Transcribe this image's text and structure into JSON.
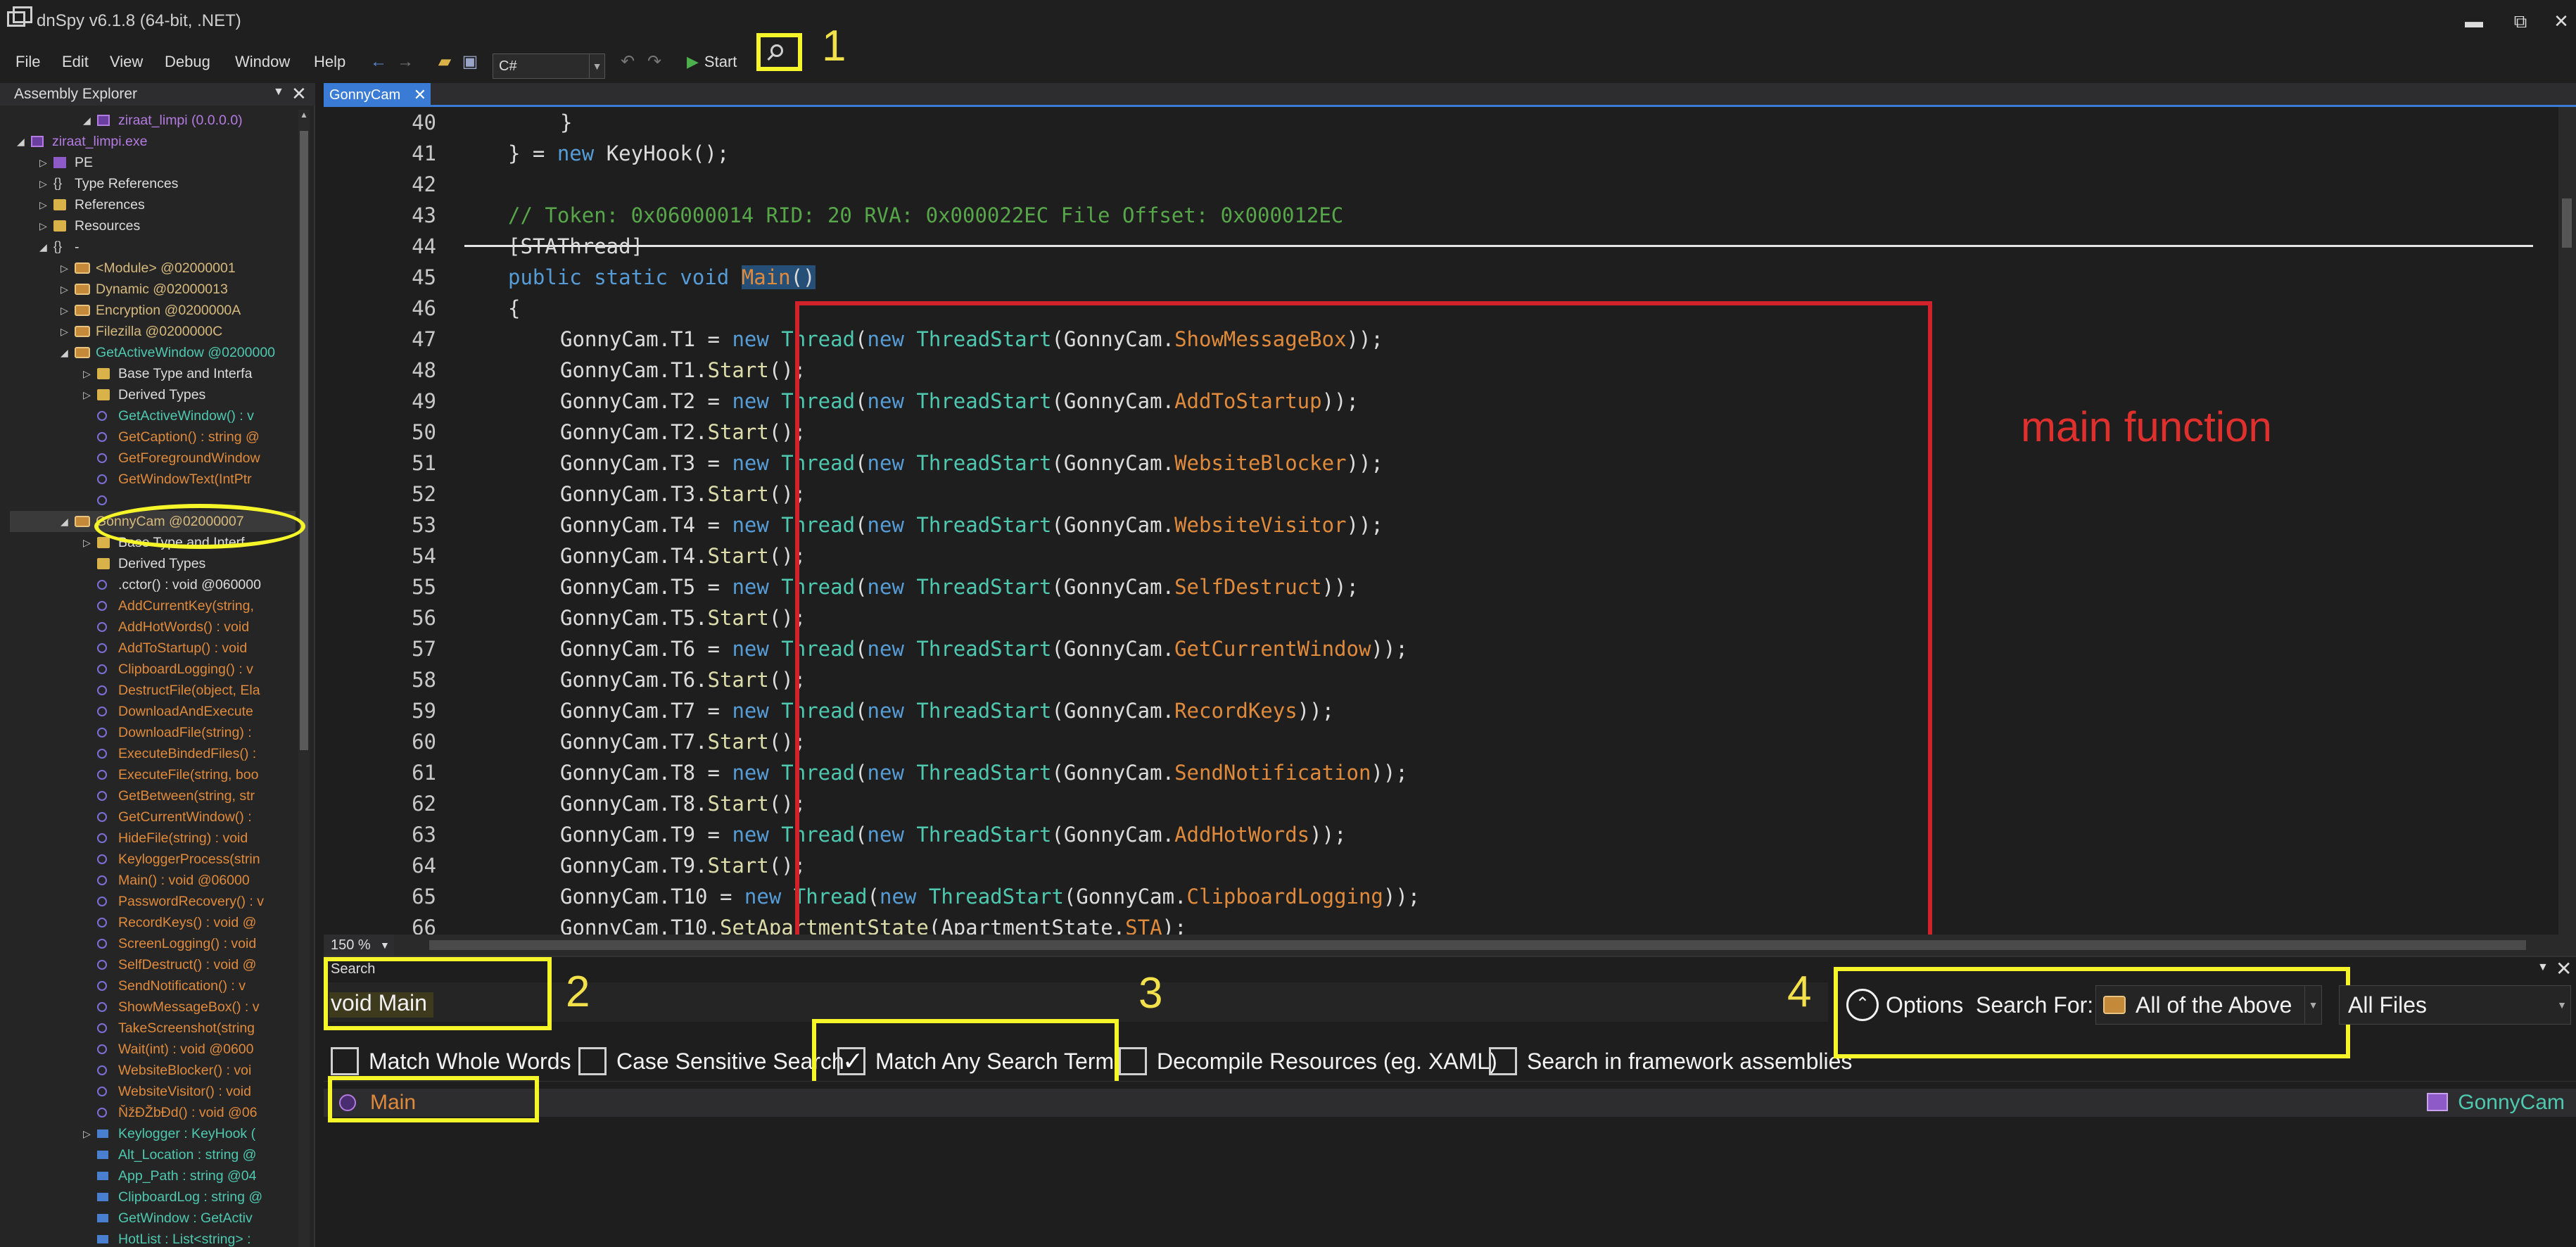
{
  "window": {
    "title": "dnSpy v6.1.8 (64-bit, .NET)",
    "min_glyph": "▬",
    "max_glyph": "⧉",
    "close_glyph": "✕",
    "colors": {
      "background": "#1e1e1e",
      "annotation": "#f5f52a",
      "main_box": "#d1222b",
      "accent": "#3a7bd5"
    }
  },
  "menu": {
    "items": [
      "File",
      "Edit",
      "View",
      "Debug",
      "Window",
      "Help"
    ],
    "language": "C#",
    "start_label": "Start",
    "icons": [
      "back-arrow-icon",
      "forward-arrow-icon",
      "open-file-icon",
      "save-all-icon",
      "undo-icon",
      "redo-icon",
      "search-icon"
    ]
  },
  "annotations": {
    "n1": "1",
    "n2": "2",
    "n3": "3",
    "n4": "4",
    "main_function": "main function"
  },
  "explorer": {
    "title": "Assembly Explorer",
    "rows": [
      {
        "text": "ziraat_limpi (0.0.0.0)",
        "color": "#b47be0"
      },
      {
        "text": "ziraat_limpi.exe",
        "color": "#b47be0"
      },
      {
        "text": "PE",
        "color": "#dcdcdc"
      },
      {
        "text": "Type References",
        "color": "#dcdcdc"
      },
      {
        "text": "References",
        "color": "#dcdcdc"
      },
      {
        "text": "Resources",
        "color": "#dcdcdc"
      },
      {
        "text": "-",
        "color": "#dcdcdc"
      },
      {
        "text": "<Module> @02000001",
        "color": "#d7ba7d"
      },
      {
        "text": "Dynamic @02000013",
        "color": "#d7ba7d"
      },
      {
        "text": "Encryption @0200000A",
        "color": "#d7ba7d"
      },
      {
        "text": "Filezilla @0200000C",
        "color": "#d7ba7d"
      },
      {
        "text": "GetActiveWindow @0200000",
        "color": "#4ec9b0"
      },
      {
        "text": "Base Type and Interfa",
        "color": "#dcdcdc"
      },
      {
        "text": "Derived Types",
        "color": "#dcdcdc"
      },
      {
        "text": "GetActiveWindow() : v",
        "color": "#4ec9b0"
      },
      {
        "text": "GetCaption() : string @",
        "color": "#e08a3c"
      },
      {
        "text": "GetForegroundWindow",
        "color": "#e08a3c"
      },
      {
        "text": "GetWindowText(IntPtr",
        "color": "#e08a3c"
      },
      {
        "text": "",
        "color": "#e08a3c"
      },
      {
        "text": "GonnyCam @02000007",
        "color": "#d7ba7d"
      },
      {
        "text": "Base Type and Interf",
        "color": "#dcdcdc"
      },
      {
        "text": "Derived Types",
        "color": "#dcdcdc"
      },
      {
        "text": ".cctor() : void @060000",
        "color": "#dcdcdc"
      },
      {
        "text": "AddCurrentKey(string,",
        "color": "#e08a3c"
      },
      {
        "text": "AddHotWords() : void",
        "color": "#e08a3c"
      },
      {
        "text": "AddToStartup() : void",
        "color": "#e08a3c"
      },
      {
        "text": "ClipboardLogging() : v",
        "color": "#e08a3c"
      },
      {
        "text": "DestructFile(object, Ela",
        "color": "#e08a3c"
      },
      {
        "text": "DownloadAndExecute",
        "color": "#e08a3c"
      },
      {
        "text": "DownloadFile(string) :",
        "color": "#e08a3c"
      },
      {
        "text": "ExecuteBindedFiles() :",
        "color": "#e08a3c"
      },
      {
        "text": "ExecuteFile(string, boo",
        "color": "#e08a3c"
      },
      {
        "text": "GetBetween(string, str",
        "color": "#e08a3c"
      },
      {
        "text": "GetCurrentWindow() :",
        "color": "#e08a3c"
      },
      {
        "text": "HideFile(string) : void",
        "color": "#e08a3c"
      },
      {
        "text": "KeyloggerProcess(strin",
        "color": "#e08a3c"
      },
      {
        "text": "Main() : void @06000",
        "color": "#e08a3c"
      },
      {
        "text": "PasswordRecovery() : v",
        "color": "#e08a3c"
      },
      {
        "text": "RecordKeys() : void @",
        "color": "#e08a3c"
      },
      {
        "text": "ScreenLogging() : void",
        "color": "#e08a3c"
      },
      {
        "text": "SelfDestruct() : void @",
        "color": "#e08a3c"
      },
      {
        "text": "SendNotification() : v",
        "color": "#e08a3c"
      },
      {
        "text": "ShowMessageBox() : v",
        "color": "#e08a3c"
      },
      {
        "text": "TakeScreenshot(string",
        "color": "#e08a3c"
      },
      {
        "text": "Wait(int) : void @0600",
        "color": "#e08a3c"
      },
      {
        "text": "WebsiteBlocker() : voi",
        "color": "#e08a3c"
      },
      {
        "text": "WebsiteVisitor() : void",
        "color": "#e08a3c"
      },
      {
        "text": "ŇžĐŽbĐd() : void @06",
        "color": "#e08a3c"
      },
      {
        "text": "Keylogger : KeyHook (",
        "color": "#4ec9b0"
      },
      {
        "text": "Alt_Location : string @",
        "color": "#4ec9b0"
      },
      {
        "text": "App_Path : string @04",
        "color": "#4ec9b0"
      },
      {
        "text": "ClipboardLog : string @",
        "color": "#4ec9b0"
      },
      {
        "text": "GetWindow : GetActiv",
        "color": "#4ec9b0"
      },
      {
        "text": "HotList : List<string> :",
        "color": "#4ec9b0"
      }
    ]
  },
  "editor": {
    "tab_label": "GonnyCam",
    "zoom": "150 %",
    "line_numbers": [
      "40",
      "41",
      "42",
      "43",
      "44",
      "45",
      "46",
      "47",
      "48",
      "49",
      "50",
      "51",
      "52",
      "53",
      "54",
      "55",
      "56",
      "57",
      "58",
      "59",
      "60",
      "61",
      "62",
      "63",
      "64",
      "65",
      "66"
    ],
    "code": {
      "l40": "}",
      "l41_a": "} = ",
      "l41_kw": "new",
      "l41_b": " KeyHook();",
      "l43": "// Token: 0x06000014 RID: 20 RVA: 0x000022EC File Offset: 0x000012EC",
      "l44": "[STAThread]",
      "l45_kw": "public static void ",
      "l45_name": "Main",
      "l45_end": "()",
      "l46": "{",
      "thread_lines": [
        {
          "t": "T1",
          "m": "ShowMessageBox"
        },
        {
          "t": "T2",
          "m": "AddToStartup"
        },
        {
          "t": "T3",
          "m": "WebsiteBlocker"
        },
        {
          "t": "T4",
          "m": "WebsiteVisitor"
        },
        {
          "t": "T5",
          "m": "SelfDestruct"
        },
        {
          "t": "T6",
          "m": "GetCurrentWindow"
        },
        {
          "t": "T7",
          "m": "RecordKeys"
        },
        {
          "t": "T8",
          "m": "SendNotification"
        },
        {
          "t": "T9",
          "m": "AddHotWords"
        },
        {
          "t": "T10",
          "m": "ClipboardLogging"
        }
      ],
      "l66_a": "GonnyCam.T10.",
      "l66_m": "SetApartmentState",
      "l66_b": "(ApartmentState.",
      "l66_c": "STA",
      "l66_d": ");"
    }
  },
  "search": {
    "pane_title": "Search",
    "query": "void Main",
    "options": [
      {
        "label": "Match Whole Words",
        "checked": false
      },
      {
        "label": "Case Sensitive Search",
        "checked": false
      },
      {
        "label": "Match Any Search Term",
        "checked": true
      },
      {
        "label": "Decompile Resources (eg. XAML)",
        "checked": false
      },
      {
        "label": "Search in framework assemblies",
        "checked": false
      }
    ],
    "options_button": "Options",
    "search_for_label": "Search For:",
    "search_for_value": "All of the Above",
    "files_value": "All Files",
    "result": {
      "name": "Main",
      "location": "GonnyCam"
    }
  }
}
